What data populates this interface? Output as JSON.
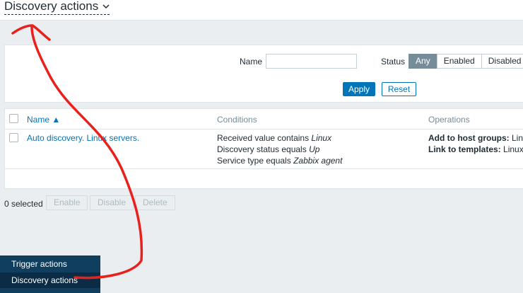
{
  "header": {
    "title": "Discovery actions"
  },
  "filter": {
    "name_label": "Name",
    "name_value": "",
    "status_label": "Status",
    "status_options": [
      "Any",
      "Enabled",
      "Disabled"
    ],
    "status_selected": "Any",
    "apply_label": "Apply",
    "reset_label": "Reset"
  },
  "table": {
    "headers": {
      "name": "Name ▲",
      "conditions": "Conditions",
      "operations": "Operations"
    },
    "rows": [
      {
        "name": "Auto discovery. Linux servers.",
        "conditions": [
          {
            "prefix": "Received value contains ",
            "value": "Linux"
          },
          {
            "prefix": "Discovery status equals ",
            "value": "Up"
          },
          {
            "prefix": "Service type equals ",
            "value": "Zabbix agent"
          }
        ],
        "operations": [
          {
            "label": "Add to host groups:",
            "value": " Linux s"
          },
          {
            "label": "Link to templates:",
            "value": " Linux by /"
          }
        ]
      }
    ]
  },
  "footer": {
    "selected": "0 selected",
    "enable_label": "Enable",
    "disable_label": "Disable",
    "delete_label": "Delete"
  },
  "menu": {
    "items": [
      {
        "label": "Trigger actions"
      },
      {
        "label": "Discovery actions"
      }
    ]
  },
  "annotation_color": "#e8211d"
}
